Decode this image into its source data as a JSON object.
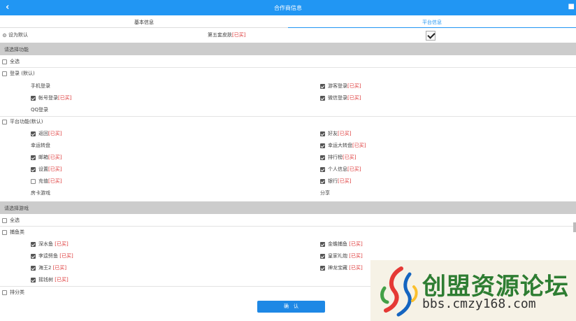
{
  "header": {
    "title": "合作商信息",
    "back": "‹",
    "gear_icon": "settings-icon"
  },
  "tabs": [
    {
      "label": "基本信息",
      "active": false
    },
    {
      "label": "平台信息",
      "active": true
    }
  ],
  "default_row": {
    "set_default": "设为默认",
    "skin_label": "第五套皮肤",
    "skin_bought": "[已买]",
    "skin_checked": true
  },
  "features": {
    "section": "请选择功能",
    "select_all": "全选",
    "login": {
      "group": "登录 (默认)",
      "items": [
        {
          "label": "手机登录",
          "bought": "",
          "checked": false,
          "col": 0,
          "show_cb": false
        },
        {
          "label": "游客登录",
          "bought": "[已买]",
          "checked": true,
          "col": 1,
          "show_cb": true
        },
        {
          "label": "帐号登录",
          "bought": "[已买]",
          "checked": true,
          "col": 0,
          "show_cb": true
        },
        {
          "label": "微信登录",
          "bought": "[已买]",
          "checked": true,
          "col": 1,
          "show_cb": true
        },
        {
          "label": "QQ登录",
          "bought": "",
          "checked": false,
          "col": 0,
          "show_cb": false
        }
      ]
    },
    "platform": {
      "group": "平台功能(默认)",
      "items": [
        {
          "label": "返回",
          "bought": "[已买]",
          "checked": true,
          "show_cb": true
        },
        {
          "label": "好友",
          "bought": "[已买]",
          "checked": true,
          "show_cb": true
        },
        {
          "label": "幸运转盘",
          "bought": "",
          "checked": false,
          "show_cb": false
        },
        {
          "label": "幸运大转盘",
          "bought": "[已买]",
          "checked": true,
          "show_cb": true
        },
        {
          "label": "邮箱",
          "bought": "[已买]",
          "checked": true,
          "show_cb": true
        },
        {
          "label": "排行榜",
          "bought": "[已买]",
          "checked": true,
          "show_cb": true
        },
        {
          "label": "设置",
          "bought": "[已买]",
          "checked": true,
          "show_cb": true
        },
        {
          "label": "个人信息",
          "bought": "[已买]",
          "checked": true,
          "show_cb": true
        },
        {
          "label": "充值",
          "bought": "[已买]",
          "checked": false,
          "show_cb": true
        },
        {
          "label": "银行",
          "bought": "[已买]",
          "checked": true,
          "show_cb": true
        },
        {
          "label": "房卡游戏",
          "bought": "",
          "checked": false,
          "show_cb": false
        },
        {
          "label": "分享",
          "bought": "",
          "checked": false,
          "show_cb": false
        }
      ]
    }
  },
  "games": {
    "section": "请选择游戏",
    "select_all": "全选",
    "fish": {
      "group": "捕鱼类",
      "items": [
        {
          "label": "深水鱼",
          "bought": " [已买]",
          "checked": true
        },
        {
          "label": "金蟾捕鱼",
          "bought": " [已买]",
          "checked": true
        },
        {
          "label": "李逵劈鱼",
          "bought": " [已买]",
          "checked": true
        },
        {
          "label": "皇家礼炮",
          "bought": " [已买]",
          "checked": true
        },
        {
          "label": "海王2",
          "bought": " [已买]",
          "checked": true
        },
        {
          "label": "神龙宝藏",
          "bought": " [已买]",
          "checked": true
        },
        {
          "label": "摇钱树",
          "bought": " [已买]",
          "checked": true
        }
      ]
    },
    "other_group": "排分类"
  },
  "confirm": "确　认",
  "watermark": {
    "cn": "创盟资源论坛",
    "url": "bbs.cmzy168.com"
  }
}
